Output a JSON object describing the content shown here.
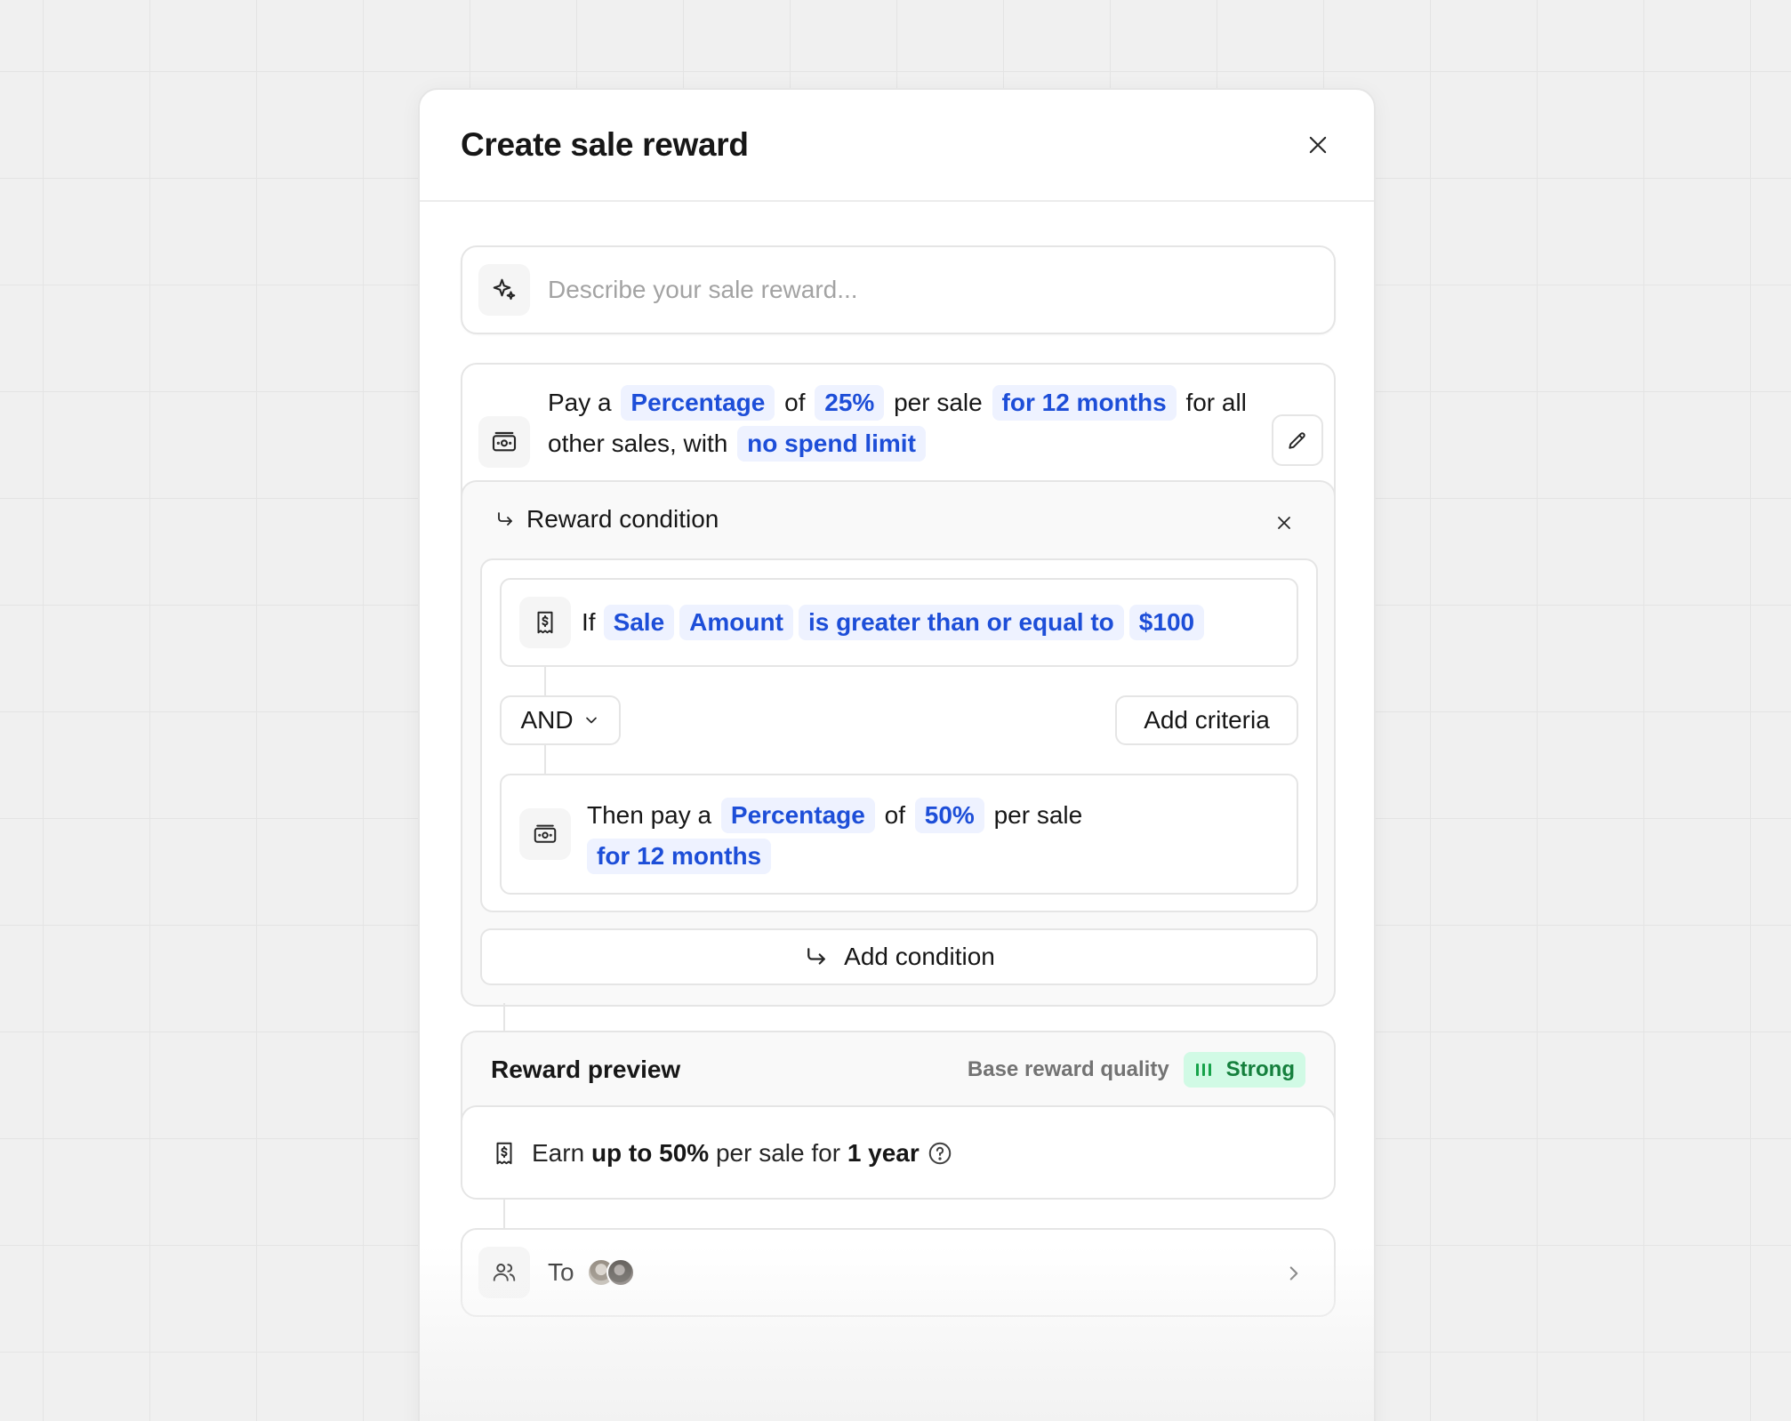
{
  "modal": {
    "title": "Create sale reward"
  },
  "describe": {
    "placeholder": "Describe your sale reward..."
  },
  "reward": {
    "pay_prefix": "Pay a",
    "type": "Percentage",
    "of": "of",
    "amount": "25%",
    "per_sale": "per sale",
    "duration": "for 12 months",
    "suffix": "for all other sales, with",
    "limit": "no spend limit"
  },
  "condition": {
    "title": "Reward condition",
    "if_label": "If",
    "entity": "Sale",
    "attribute": "Amount",
    "operator": "is greater than or equal to",
    "value": "$100",
    "logic": "AND",
    "add_criteria": "Add criteria",
    "then_prefix": "Then pay a",
    "then_type": "Percentage",
    "then_of": "of",
    "then_amount": "50%",
    "then_per_sale": "per sale",
    "then_duration": "for 12 months",
    "add_condition": "Add condition"
  },
  "preview": {
    "title": "Reward preview",
    "quality_label": "Base reward quality",
    "quality_value": "Strong",
    "earn": "Earn",
    "upto": "up to 50%",
    "per_sale_for": "per sale for",
    "period": "1 year"
  },
  "to": {
    "label": "To"
  },
  "colors": {
    "accent_pill_bg": "#eef2ff",
    "accent_pill_text": "#1d4ed8",
    "strong_bg": "#d1fae5",
    "strong_text": "#15803d"
  }
}
